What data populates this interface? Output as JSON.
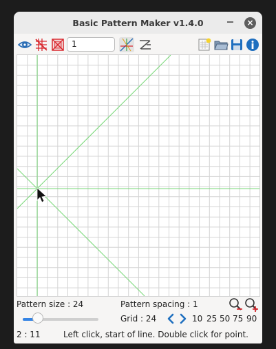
{
  "window": {
    "title": "Basic Pattern Maker v1.4.0",
    "minimize_label": "–",
    "close_label": "×"
  },
  "toolbar": {
    "icons": [
      "eye-icon",
      "grid-toggle-icon",
      "frame-toggle-icon",
      "line-tool-icon",
      "crossing-lines-icon",
      "new-file-icon",
      "open-folder-icon",
      "save-icon",
      "info-icon"
    ],
    "value": "1"
  },
  "status": {
    "pattern_size": "Pattern size : 24",
    "pattern_spacing": "Pattern spacing : 1",
    "grid": "Grid : 24",
    "slider_fraction": 0.2,
    "presets": [
      "10",
      "25",
      "50",
      "75",
      "90"
    ],
    "coords": "2 : 11",
    "hint": "Left click, start of line.  Double click for point."
  },
  "colors": {
    "accent": "#3584e4",
    "grid_line": "#d4d4d4",
    "guide_line": "#76d776",
    "red_icon": "#d8262c"
  }
}
